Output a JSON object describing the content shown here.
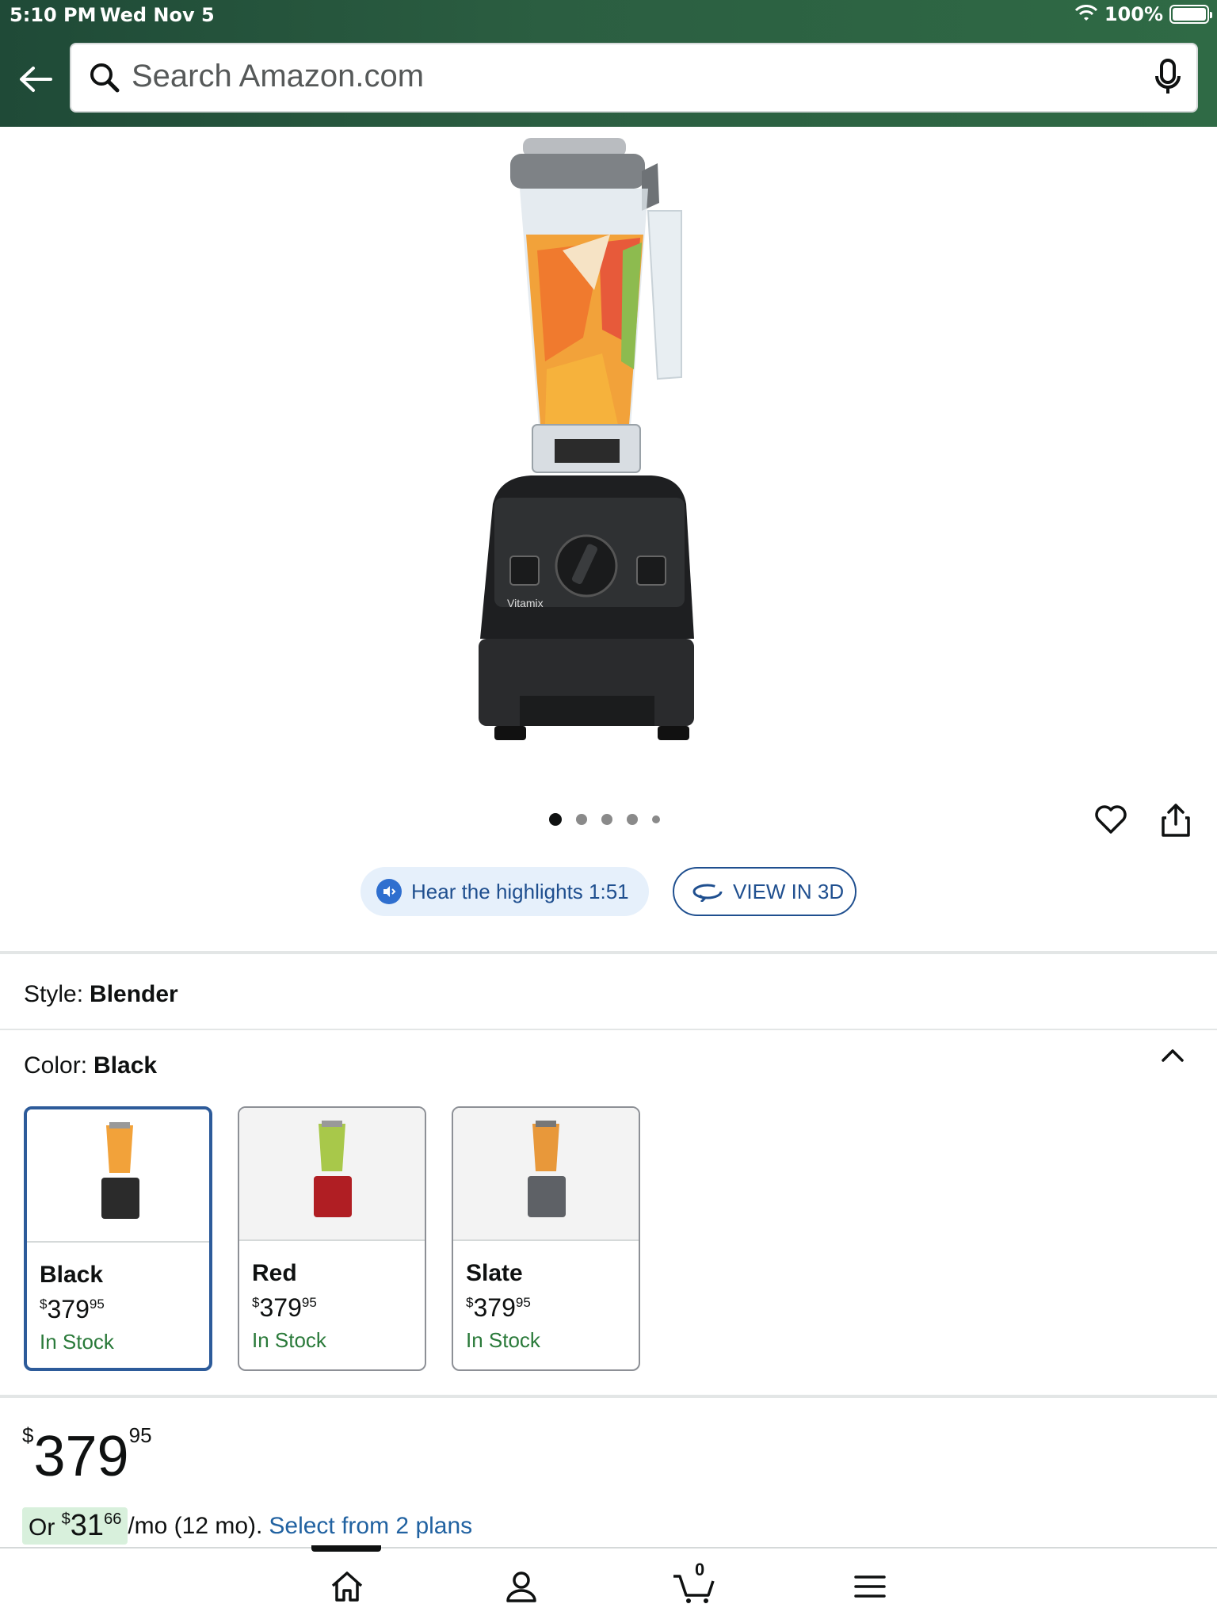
{
  "status_bar": {
    "time": "5:10 PM",
    "date": "Wed Nov 5",
    "battery": "100%"
  },
  "header": {
    "search_placeholder": "Search Amazon.com",
    "icons": [
      "back-arrow-icon",
      "search-icon",
      "microphone-icon"
    ]
  },
  "gallery": {
    "image_count": 5,
    "active_index": 0,
    "hear_highlights_label": "Hear the highlights 1:51",
    "view_3d_label": "VIEW IN 3D"
  },
  "style": {
    "label": "Style:",
    "value": "Blender"
  },
  "color": {
    "label": "Color:",
    "value": "Black",
    "options": [
      {
        "name": "Black",
        "currency": "$",
        "whole": "379",
        "cents": "95",
        "stock": "In Stock",
        "selected": true,
        "accent": "#2b2b2b"
      },
      {
        "name": "Red",
        "currency": "$",
        "whole": "379",
        "cents": "95",
        "stock": "In Stock",
        "selected": false,
        "accent": "#b01e23"
      },
      {
        "name": "Slate",
        "currency": "$",
        "whole": "379",
        "cents": "95",
        "stock": "In Stock",
        "selected": false,
        "accent": "#5e6166"
      }
    ]
  },
  "price": {
    "currency": "$",
    "whole": "379",
    "cents": "95"
  },
  "monthly": {
    "prefix": "Or",
    "currency": "$",
    "whole": "31",
    "cents": "66",
    "suffix": "/mo (12 mo).",
    "link": "Select from 2 plans"
  },
  "bottom_nav": {
    "cart_count": "0",
    "items": [
      "home-icon",
      "account-icon",
      "cart-icon",
      "menu-icon"
    ]
  },
  "colors": {
    "header_green": "#2b5e41",
    "link_blue": "#2162a1",
    "stock_green": "#2a7a3a",
    "selected_border": "#2d5b9a"
  }
}
